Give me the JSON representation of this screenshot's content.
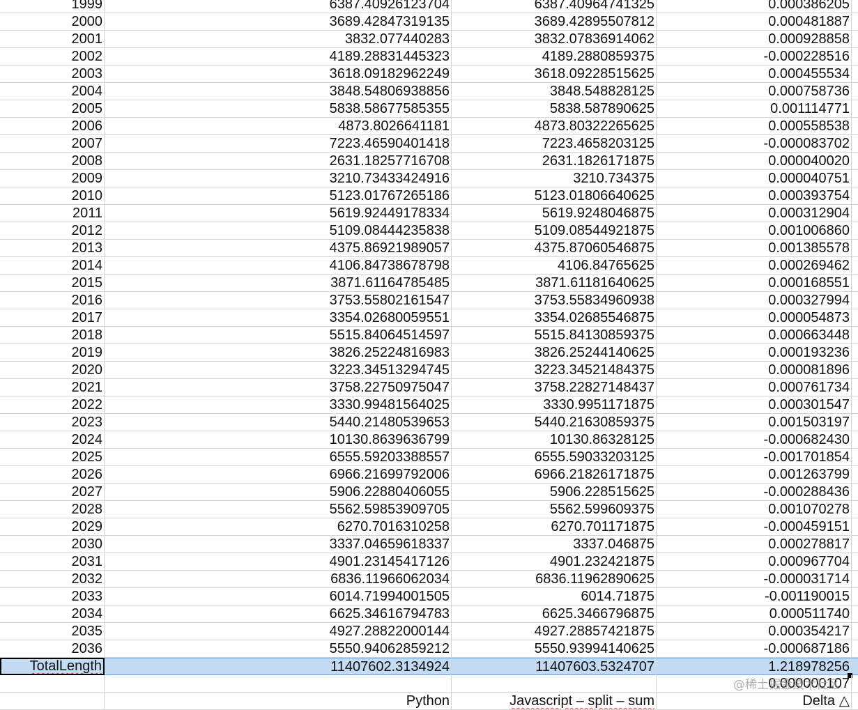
{
  "partial_top_row": {
    "year": "1999",
    "python": "6387.40926123704",
    "javascript": "6387.40964741325",
    "delta": "0.000386205"
  },
  "rows": [
    {
      "year": "2000",
      "python": "3689.42847319135",
      "javascript": "3689.42895507812",
      "delta": "0.000481887"
    },
    {
      "year": "2001",
      "python": "3832.077440283",
      "javascript": "3832.07836914062",
      "delta": "0.000928858"
    },
    {
      "year": "2002",
      "python": "4189.28831445323",
      "javascript": "4189.2880859375",
      "delta": "-0.000228516"
    },
    {
      "year": "2003",
      "python": "3618.09182962249",
      "javascript": "3618.09228515625",
      "delta": "0.000455534"
    },
    {
      "year": "2004",
      "python": "3848.54806938856",
      "javascript": "3848.548828125",
      "delta": "0.000758736"
    },
    {
      "year": "2005",
      "python": "5838.58677585355",
      "javascript": "5838.587890625",
      "delta": "0.001114771"
    },
    {
      "year": "2006",
      "python": "4873.8026641181",
      "javascript": "4873.80322265625",
      "delta": "0.000558538"
    },
    {
      "year": "2007",
      "python": "7223.46590401418",
      "javascript": "7223.4658203125",
      "delta": "-0.000083702"
    },
    {
      "year": "2008",
      "python": "2631.18257716708",
      "javascript": "2631.1826171875",
      "delta": "0.000040020"
    },
    {
      "year": "2009",
      "python": "3210.73433424916",
      "javascript": "3210.734375",
      "delta": "0.000040751"
    },
    {
      "year": "2010",
      "python": "5123.01767265186",
      "javascript": "5123.01806640625",
      "delta": "0.000393754"
    },
    {
      "year": "2011",
      "python": "5619.92449178334",
      "javascript": "5619.9248046875",
      "delta": "0.000312904"
    },
    {
      "year": "2012",
      "python": "5109.08444235838",
      "javascript": "5109.08544921875",
      "delta": "0.001006860"
    },
    {
      "year": "2013",
      "python": "4375.86921989057",
      "javascript": "4375.87060546875",
      "delta": "0.001385578"
    },
    {
      "year": "2014",
      "python": "4106.84738678798",
      "javascript": "4106.84765625",
      "delta": "0.000269462"
    },
    {
      "year": "2015",
      "python": "3871.61164785485",
      "javascript": "3871.61181640625",
      "delta": "0.000168551"
    },
    {
      "year": "2016",
      "python": "3753.55802161547",
      "javascript": "3753.55834960938",
      "delta": "0.000327994"
    },
    {
      "year": "2017",
      "python": "3354.02680059551",
      "javascript": "3354.02685546875",
      "delta": "0.000054873"
    },
    {
      "year": "2018",
      "python": "5515.84064514597",
      "javascript": "5515.84130859375",
      "delta": "0.000663448"
    },
    {
      "year": "2019",
      "python": "3826.25224816983",
      "javascript": "3826.25244140625",
      "delta": "0.000193236"
    },
    {
      "year": "2020",
      "python": "3223.34513294745",
      "javascript": "3223.34521484375",
      "delta": "0.000081896"
    },
    {
      "year": "2021",
      "python": "3758.22750975047",
      "javascript": "3758.22827148437",
      "delta": "0.000761734"
    },
    {
      "year": "2022",
      "python": "3330.99481564025",
      "javascript": "3330.9951171875",
      "delta": "0.000301547"
    },
    {
      "year": "2023",
      "python": "5440.21480539653",
      "javascript": "5440.21630859375",
      "delta": "0.001503197"
    },
    {
      "year": "2024",
      "python": "10130.8639636799",
      "javascript": "10130.86328125",
      "delta": "-0.000682430"
    },
    {
      "year": "2025",
      "python": "6555.59203388557",
      "javascript": "6555.59033203125",
      "delta": "-0.001701854"
    },
    {
      "year": "2026",
      "python": "6966.21699792006",
      "javascript": "6966.21826171875",
      "delta": "0.001263799"
    },
    {
      "year": "2027",
      "python": "5906.22880406055",
      "javascript": "5906.228515625",
      "delta": "-0.000288436"
    },
    {
      "year": "2028",
      "python": "5562.59853909705",
      "javascript": "5562.599609375",
      "delta": "0.001070278"
    },
    {
      "year": "2029",
      "python": "6270.7016310258",
      "javascript": "6270.701171875",
      "delta": "-0.000459151"
    },
    {
      "year": "2030",
      "python": "3337.04659618337",
      "javascript": "3337.046875",
      "delta": "0.000278817"
    },
    {
      "year": "2031",
      "python": "4901.23145417126",
      "javascript": "4901.232421875",
      "delta": "0.000967704"
    },
    {
      "year": "2032",
      "python": "6836.11966062034",
      "javascript": "6836.11962890625",
      "delta": "-0.000031714"
    },
    {
      "year": "2033",
      "python": "6014.71994001505",
      "javascript": "6014.71875",
      "delta": "-0.001190015"
    },
    {
      "year": "2034",
      "python": "6625.34616794783",
      "javascript": "6625.3466796875",
      "delta": "0.000511740"
    },
    {
      "year": "2035",
      "python": "4927.28822000144",
      "javascript": "4927.28857421875",
      "delta": "0.000354217"
    },
    {
      "year": "2036",
      "python": "5550.94062859212",
      "javascript": "5550.93994140625",
      "delta": "-0.000687186"
    }
  ],
  "total_row": {
    "label": "TotalLength",
    "python": "11407602.3134924",
    "javascript": "11407603.5324707",
    "delta": "1.218978256"
  },
  "ratio_row": {
    "delta": "0.000000107"
  },
  "header_row": {
    "python": "Python",
    "javascript": "Javascript – split – sum",
    "delta": "Delta △"
  },
  "watermark": "@稀土掘金技术社区"
}
